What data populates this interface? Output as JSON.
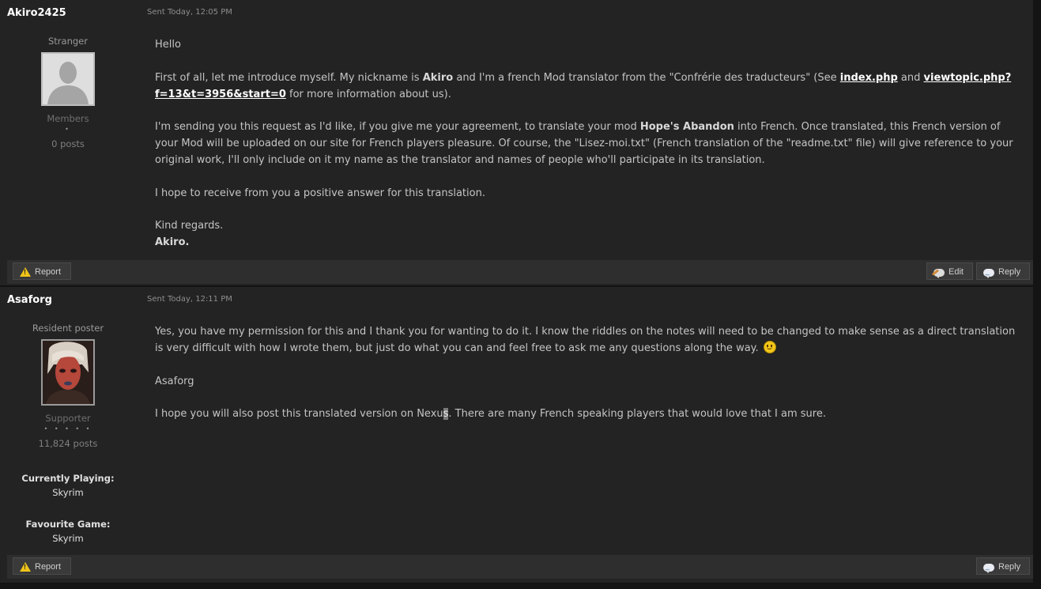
{
  "posts": [
    {
      "author": "Akiro2425",
      "sent": "Sent Today, 12:05 PM",
      "rank": "Stranger",
      "group": "Members",
      "pips": "•",
      "postcount": "0 posts",
      "greeting": "Hello",
      "p2_a": "First of all, let me introduce myself. My nickname is ",
      "p2_b": "Akiro",
      "p2_c": " and I'm a french Mod translator from the \"Confrérie des traducteurs\" (See ",
      "link1": "index.php",
      "p2_d": " and ",
      "link2": "viewtopic.php?f=13&t=3956&start=0",
      "p2_e": " for more information about us).",
      "p3_a": "I'm sending you this request as I'd like, if you give me your agreement, to translate your mod ",
      "p3_b": "Hope's Abandon",
      "p3_c": " into French. Once translated, this French version of your Mod will be uploaded on our site for French players pleasure. Of course, the \"Lisez-moi.txt\" (French translation of the \"readme.txt\" file) will give reference to your original work, I'll only include on it my name as the translator and names of people who'll participate in its translation.",
      "p4": "I hope to receive from you a positive answer for this translation.",
      "p5": "Kind regards.",
      "signature": "Akiro.",
      "report_label": "Report",
      "edit_label": "Edit",
      "reply_label": "Reply"
    },
    {
      "author": "Asaforg",
      "sent": "Sent Today, 12:11 PM",
      "rank": "Resident poster",
      "group": "Supporter",
      "pips": "• • • • •",
      "postcount": "11,824 posts",
      "currently_playing_label": "Currently Playing:",
      "currently_playing": "Skyrim",
      "favourite_game_label": "Favourite Game:",
      "favourite_game": "Skyrim",
      "p1": "Yes, you have my permission for this and I thank you for wanting to do it. I know the riddles on the notes will need to be changed to make sense as a direct translation is very difficult with how I wrote them, but just do what you can and feel free to ask me any questions along the way.",
      "p2": "Asaforg",
      "p3_a": "I hope you will also post this translated version on Nexu",
      "p3_b": "s",
      "p3_c": ". There are many French speaking players that would love that I am sure.",
      "report_label": "Report",
      "reply_label": "Reply"
    }
  ]
}
